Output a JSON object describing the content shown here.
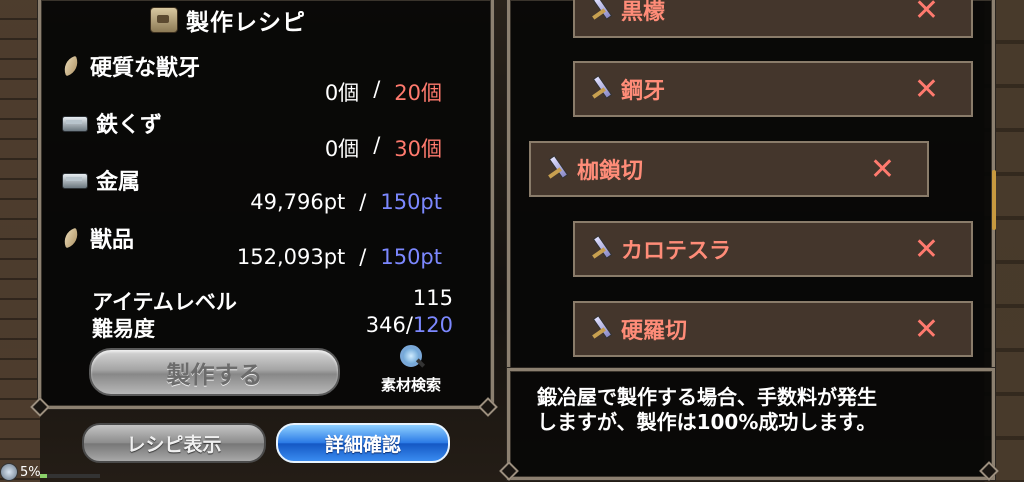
{
  "title": "製作レシピ",
  "materials": [
    {
      "name": "硬質な獣牙",
      "icon": "fang-icon",
      "have": "0個",
      "need": "20個",
      "need_color": "red"
    },
    {
      "name": "鉄くず",
      "icon": "ingot-icon",
      "have": "0個",
      "need": "30個",
      "need_color": "red"
    },
    {
      "name": "金属",
      "icon": "ingot-icon",
      "have": "49,796pt",
      "need": "150pt",
      "need_color": "blue"
    },
    {
      "name": "獣品",
      "icon": "fang-icon",
      "have": "152,093pt",
      "need": "150pt",
      "need_color": "blue"
    }
  ],
  "separator": "/",
  "stats": {
    "item_level_label": "アイテムレベル",
    "item_level_value": "115",
    "difficulty_label": "難易度",
    "difficulty_value": "346",
    "difficulty_slash": "/",
    "difficulty_max": "120"
  },
  "buttons": {
    "craft": "製作する",
    "material_search": "素材検索",
    "show_recipe": "レシピ表示",
    "details": "詳細確認"
  },
  "status": {
    "percent": "5%",
    "fill": 0.12
  },
  "recipes": [
    {
      "name": "黒檬",
      "selected": false
    },
    {
      "name": "鋼牙",
      "selected": false
    },
    {
      "name": "枷鎖切",
      "selected": true
    },
    {
      "name": "カロテスラ",
      "selected": false
    },
    {
      "name": "硬羅切",
      "selected": false
    }
  ],
  "remove_symbol": "✕",
  "description": {
    "line1": "鍛冶屋で製作する場合、手数料が発生",
    "line2": "しますが、製作は100%成功します。"
  },
  "colors": {
    "need_red": "#ff7a6e",
    "need_blue": "#7c88ff",
    "recipe_text": "#ff8c78"
  }
}
